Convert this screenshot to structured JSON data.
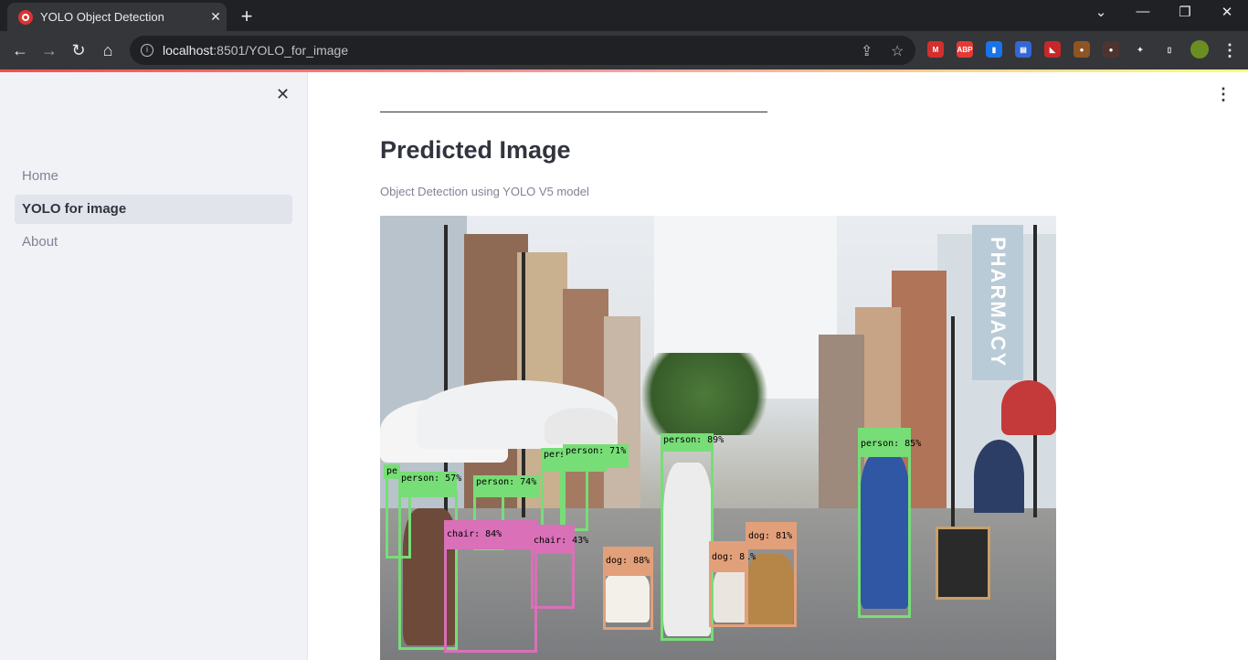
{
  "browser": {
    "tab_title": "YOLO Object Detection",
    "tab_close": "✕",
    "new_tab": "+",
    "url_host": "localhost",
    "url_path": ":8501/YOLO_for_image",
    "win_min": "—",
    "win_restore": "❐",
    "win_close": "✕",
    "win_dropdown": "⌄",
    "back": "←",
    "forward": "→",
    "reload": "↻",
    "home": "⌂",
    "share": "⇪",
    "star": "☆",
    "extensions": [
      {
        "name": "m-extension-icon",
        "text": "M",
        "color": "#d32f2f"
      },
      {
        "name": "adblock-plus-icon",
        "text": "ABP",
        "color": "#e53935"
      },
      {
        "name": "bookmark-extension-icon",
        "text": "▮",
        "color": "#1a73e8"
      },
      {
        "name": "save-extension-icon",
        "text": "▤",
        "color": "#3367d6"
      },
      {
        "name": "chart-extension-icon",
        "text": "◣",
        "color": "#c62828"
      },
      {
        "name": "cookie-extension-icon",
        "text": "●",
        "color": "#8d5524"
      },
      {
        "name": "dark-extension-icon",
        "text": "●",
        "color": "#4e342e"
      },
      {
        "name": "puzzle-icon",
        "text": "✦",
        "color": "#35363a"
      },
      {
        "name": "sidepanel-icon",
        "text": "▯",
        "color": "#35363a"
      },
      {
        "name": "profile-avatar",
        "text": "",
        "color": "#6b8e23"
      }
    ],
    "menu": "⋮"
  },
  "sidebar": {
    "close": "✕",
    "items": [
      {
        "label": "Home",
        "active": false
      },
      {
        "label": "YOLO for image",
        "active": true
      },
      {
        "label": "About",
        "active": false
      }
    ]
  },
  "main": {
    "menu": "⋮",
    "title": "Predicted Image",
    "caption": "Object Detection using YOLO V5 model"
  },
  "image": {
    "pharmacy_sign": "PHARMACY",
    "detections": [
      {
        "label": "pe",
        "color": "#77dd77"
      },
      {
        "label": "person: 57%",
        "color": "#77dd77"
      },
      {
        "label": "person: 74%",
        "color": "#77dd77"
      },
      {
        "label": "person: 82%",
        "color": "#77dd77"
      },
      {
        "label": "person: 71%",
        "color": "#77dd77"
      },
      {
        "label": "person: 89%",
        "color": "#77dd77"
      },
      {
        "label": "person: 85%",
        "color": "#77dd77"
      },
      {
        "label": "chair: 84%",
        "color": "#d970b8"
      },
      {
        "label": "chair: 43%",
        "color": "#d970b8"
      },
      {
        "label": "dog: 88%",
        "color": "#e2a07a"
      },
      {
        "label": "dog: 81%",
        "color": "#e2a07a"
      },
      {
        "label": "dog: 81%",
        "color": "#e2a07a"
      }
    ]
  }
}
